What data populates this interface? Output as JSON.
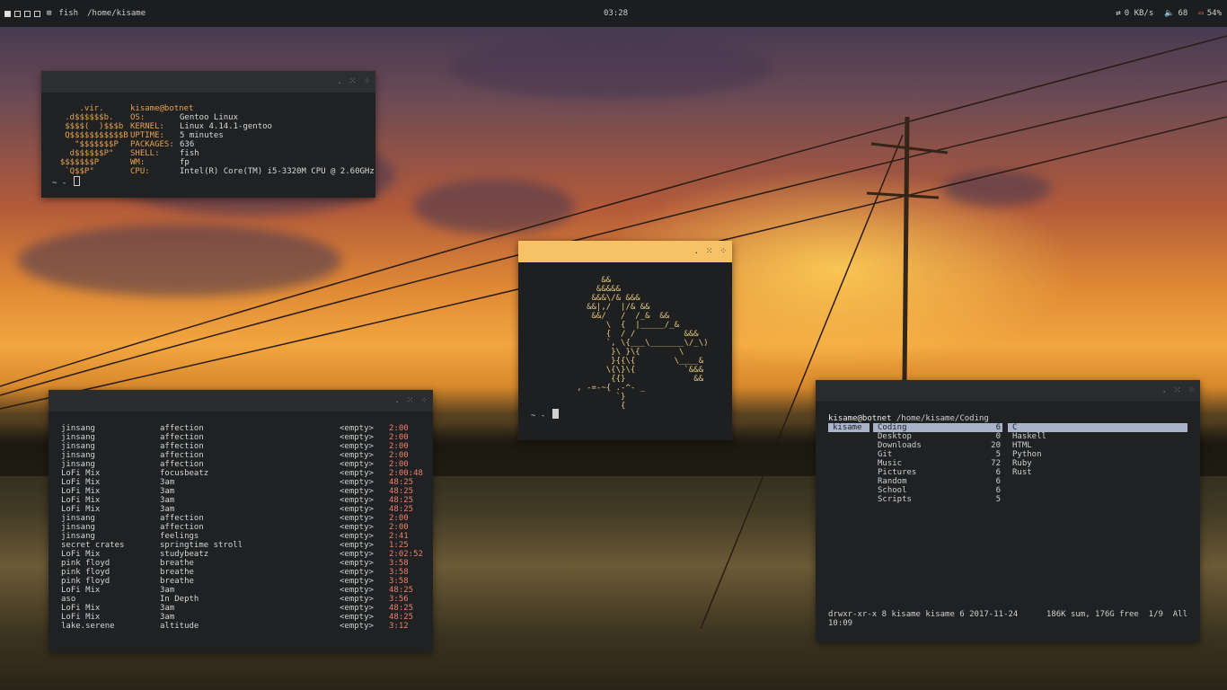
{
  "topbar": {
    "workspaces": [
      true,
      false,
      false,
      false
    ],
    "layout_icon": "tiling-layout-icon",
    "app": "fish",
    "path": "/home/kisame",
    "clock": "03:28",
    "network": "0 KB/s",
    "volume": "68",
    "battery": "54%"
  },
  "neofetch": {
    "user": "kisame@botnet",
    "art": [
      "      .vir.",
      "   .d$$$$$$b.",
      "   $$$$(  )$$$b",
      "   Q$$$$$$$$$$$B",
      "     \"$$$$$$$P",
      "    d$$$$$$P\"",
      "  $$$$$$$P",
      "   `Q$$P\""
    ],
    "fields": [
      {
        "key": "OS:",
        "value": "Gentoo Linux"
      },
      {
        "key": "KERNEL:",
        "value": "Linux 4.14.1-gentoo"
      },
      {
        "key": "UPTIME:",
        "value": "5 minutes"
      },
      {
        "key": "PACKAGES:",
        "value": "636"
      },
      {
        "key": "SHELL:",
        "value": "fish"
      },
      {
        "key": "WM:",
        "value": "fp"
      },
      {
        "key": "CPU:",
        "value": "Intel(R) Core(TM) i5-3320M CPU @ 2.60GHz"
      }
    ],
    "prompt": "~ -"
  },
  "art_window": {
    "lines": [
      "        &&",
      "       &&&&&",
      "      &&&\\/& &&&",
      "     &&|,/  |/& &&",
      "      &&/   /  /_&  &&",
      "         \\  {  |_____/_&",
      "         {  / /          &&&",
      "         `, \\{___\\_______\\/_\\)",
      "          }\\ }\\{        \\",
      "          }{{\\{        \\____&",
      "         \\{\\}\\{          `&&&",
      "          {{}              &&",
      "   , -=-~{ .-^- _",
      "           `}",
      "            {"
    ],
    "prompt": "~ -"
  },
  "music": {
    "rows": [
      {
        "artist": "jinsang",
        "title": "affection",
        "album": "<empty>",
        "time": "2:00"
      },
      {
        "artist": "jinsang",
        "title": "affection",
        "album": "<empty>",
        "time": "2:00"
      },
      {
        "artist": "jinsang",
        "title": "affection",
        "album": "<empty>",
        "time": "2:00"
      },
      {
        "artist": "jinsang",
        "title": "affection",
        "album": "<empty>",
        "time": "2:00"
      },
      {
        "artist": "jinsang",
        "title": "affection",
        "album": "<empty>",
        "time": "2:00"
      },
      {
        "artist": "LoFi Mix",
        "title": "focusbeatz",
        "album": "<empty>",
        "time": "2:00:48"
      },
      {
        "artist": "LoFi Mix",
        "title": "3am",
        "album": "<empty>",
        "time": "48:25"
      },
      {
        "artist": "LoFi Mix",
        "title": "3am",
        "album": "<empty>",
        "time": "48:25"
      },
      {
        "artist": "LoFi Mix",
        "title": "3am",
        "album": "<empty>",
        "time": "48:25"
      },
      {
        "artist": "LoFi Mix",
        "title": "3am",
        "album": "<empty>",
        "time": "48:25"
      },
      {
        "artist": "jinsang",
        "title": "affection",
        "album": "<empty>",
        "time": "2:00"
      },
      {
        "artist": "jinsang",
        "title": "affection",
        "album": "<empty>",
        "time": "2:00"
      },
      {
        "artist": "jinsang",
        "title": "feelings",
        "album": "<empty>",
        "time": "2:41"
      },
      {
        "artist": "secret crates",
        "title": "springtime stroll",
        "album": "<empty>",
        "time": "1:25"
      },
      {
        "artist": "LoFi Mix",
        "title": "studybeatz",
        "album": "<empty>",
        "time": "2:02:52"
      },
      {
        "artist": "pink floyd",
        "title": "breathe",
        "album": "<empty>",
        "time": "3:58"
      },
      {
        "artist": "pink floyd",
        "title": "breathe",
        "album": "<empty>",
        "time": "3:58"
      },
      {
        "artist": "pink floyd",
        "title": "breathe",
        "album": "<empty>",
        "time": "3:58"
      },
      {
        "artist": "LoFi Mix",
        "title": "3am",
        "album": "<empty>",
        "time": "48:25"
      },
      {
        "artist": "aso",
        "title": "In Depth",
        "album": "<empty>",
        "time": "3:56"
      },
      {
        "artist": "LoFi Mix",
        "title": "3am",
        "album": "<empty>",
        "time": "48:25"
      },
      {
        "artist": "LoFi Mix",
        "title": "3am",
        "album": "<empty>",
        "time": "48:25"
      },
      {
        "artist": "lake.serene",
        "title": "altitude",
        "album": "<empty>",
        "time": "3:12"
      }
    ]
  },
  "ranger": {
    "user": "kisame@botnet",
    "path": "/home/kisame/Coding",
    "parent": "kisame",
    "dirs": [
      {
        "name": "Coding",
        "count": "6",
        "selected": true
      },
      {
        "name": "Desktop",
        "count": "0"
      },
      {
        "name": "Downloads",
        "count": "20"
      },
      {
        "name": "Git",
        "count": "5"
      },
      {
        "name": "Music",
        "count": "72"
      },
      {
        "name": "Pictures",
        "count": "6"
      },
      {
        "name": "Random",
        "count": "6"
      },
      {
        "name": "School",
        "count": "6"
      },
      {
        "name": "Scripts",
        "count": "5"
      }
    ],
    "preview": [
      {
        "name": "C",
        "selected": true
      },
      {
        "name": "Haskell"
      },
      {
        "name": "HTML"
      },
      {
        "name": "Python"
      },
      {
        "name": "Ruby"
      },
      {
        "name": "Rust"
      }
    ],
    "status_left": "drwxr-xr-x 8 kisame kisame 6 2017-11-24 10:09",
    "status_right": "186K sum, 176G free  1/9  All"
  }
}
